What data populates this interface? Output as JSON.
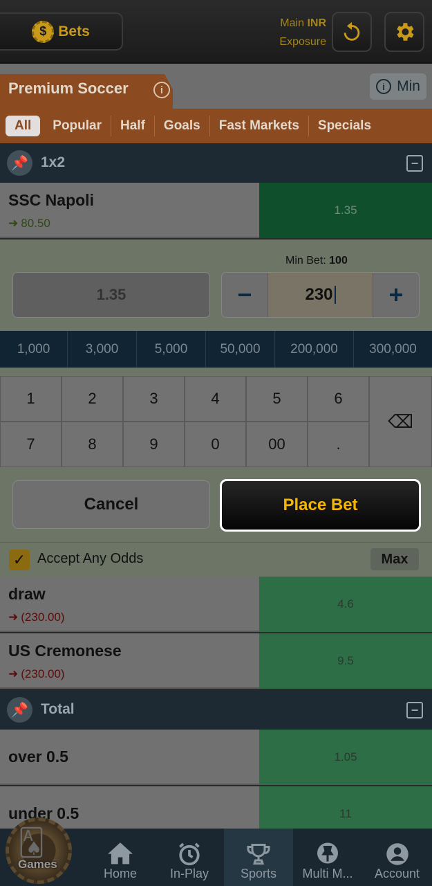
{
  "header": {
    "bets_label": "Bets",
    "coin_symbol": "$",
    "main_label": "Main",
    "currency": "INR",
    "exposure_label": "Exposure",
    "refresh_icon": "refresh-icon",
    "settings_icon": "gear-icon"
  },
  "title": {
    "text": "Premium Soccer",
    "info_symbol": "i",
    "min_label": "Min"
  },
  "tabs": [
    "All",
    "Popular",
    "Half",
    "Goals",
    "Fast Markets",
    "Specials"
  ],
  "market_1x2": {
    "label": "1x2",
    "collapse_symbol": "−",
    "selected": {
      "name": "SSC Napoli",
      "sub": "80.50",
      "odds": "1.35"
    },
    "others": [
      {
        "name": "draw",
        "sub": "(230.00)",
        "odds": "4.6"
      },
      {
        "name": "US Cremonese",
        "sub": "(230.00)",
        "odds": "9.5"
      }
    ]
  },
  "betslip": {
    "min_bet_label": "Min Bet:",
    "min_bet_value": "100",
    "odds_value": "1.35",
    "stake": "230",
    "minus": "−",
    "plus": "+",
    "quick_stakes": [
      "1,000",
      "3,000",
      "5,000",
      "50,000",
      "200,000",
      "300,000"
    ],
    "keys_row1": [
      "1",
      "2",
      "3",
      "4",
      "5",
      "6"
    ],
    "keys_row2": [
      "7",
      "8",
      "9",
      "0",
      "00",
      "."
    ],
    "backspace_symbol": "⌫",
    "cancel_label": "Cancel",
    "place_label": "Place Bet",
    "accept_label": "Accept Any Odds",
    "accept_checked": true,
    "check_symbol": "✓",
    "max_label": "Max"
  },
  "market_total": {
    "label": "Total",
    "collapse_symbol": "−",
    "rows": [
      {
        "name": "over 0.5",
        "odds": "1.05"
      },
      {
        "name": "under 0.5",
        "odds": "11"
      }
    ]
  },
  "bottom_nav": {
    "games_label": "Games",
    "items": [
      {
        "label": "Home",
        "icon": "home-icon"
      },
      {
        "label": "In-Play",
        "icon": "clock-icon"
      },
      {
        "label": "Sports",
        "icon": "trophy-icon"
      },
      {
        "label": "Multi M...",
        "icon": "pin-icon"
      },
      {
        "label": "Account",
        "icon": "user-icon"
      }
    ]
  },
  "colors": {
    "accent_orange": "#8b4a1f",
    "place_bet_text": "#f5b500",
    "odds_green": "#2d6e47"
  }
}
